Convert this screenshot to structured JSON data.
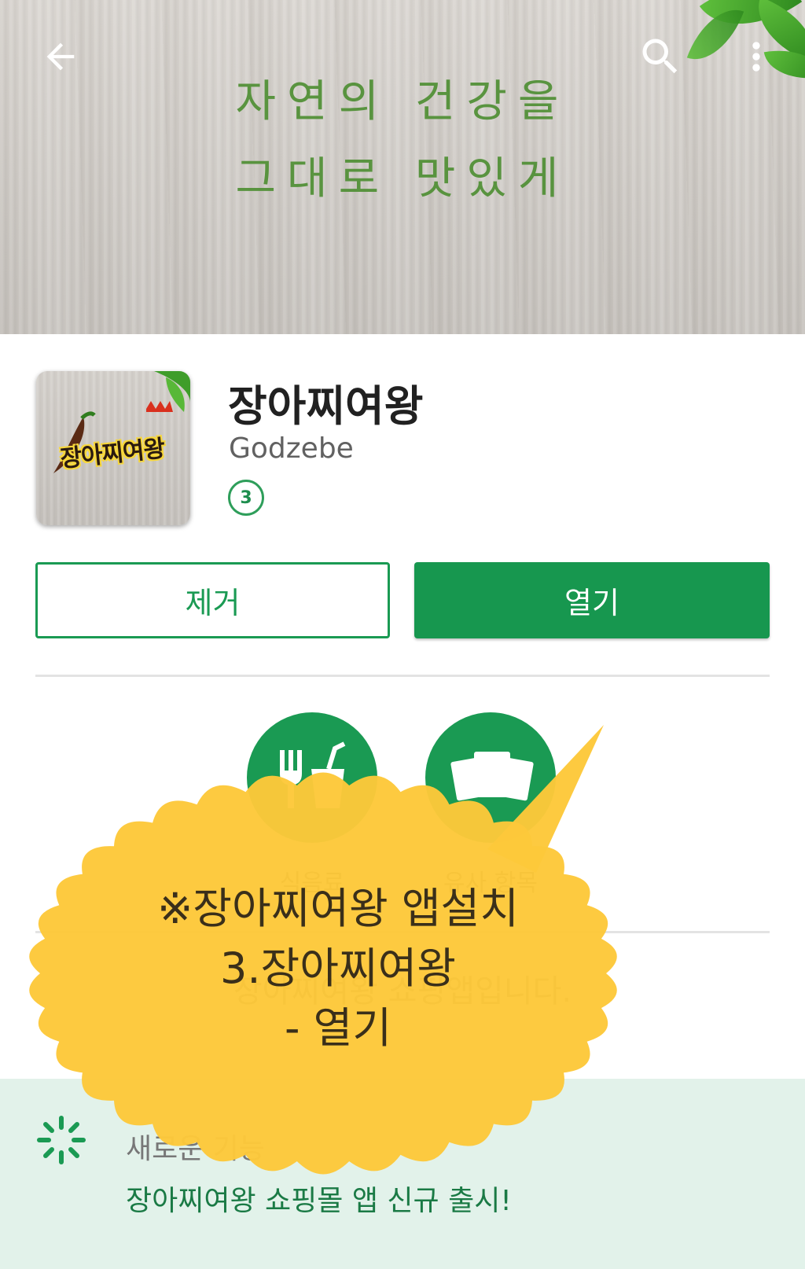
{
  "header": {
    "line1": "자연의 건강을",
    "line2": "그대로 맛있게",
    "back_icon": "arrow-left-icon",
    "search_icon": "search-icon",
    "menu_icon": "more-vert-icon"
  },
  "app": {
    "name": "장아찌여왕",
    "developer": "Godzebe",
    "content_rating": "3",
    "icon_text": "장아찌여왕"
  },
  "buttons": {
    "uninstall": "제거",
    "open": "열기"
  },
  "categories": [
    {
      "label": "식음료",
      "icon": "food-drink-icon"
    },
    {
      "label": "유사 항목",
      "icon": "similar-items-icon"
    }
  ],
  "description": "장아찌여왕 쇼핑앱입니다.",
  "whats_new": {
    "title": "새로운 기능",
    "text": "장아찌여왕 쇼핑몰 앱 신규 출시!",
    "icon": "sparkle-icon"
  },
  "callout": {
    "line1": "※장아찌여왕 앱설치",
    "line2": "3.장아찌여왕",
    "line3": "- 열기"
  },
  "colors": {
    "accent": "#17974f",
    "callout": "#fdc83a",
    "whats_new_bg": "#e2f2ea"
  }
}
